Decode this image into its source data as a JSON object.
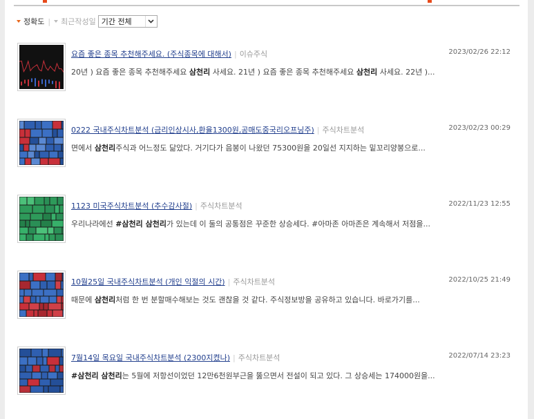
{
  "header": {
    "top_right_text": "…"
  },
  "sort": {
    "accuracy_label": "정확도",
    "recent_label": "최근작성일",
    "period_selected": "기간 전체"
  },
  "results": [
    {
      "title": "요즘 좋은 종목 추천해주세요. (주식종목에 대해서)",
      "category": "이슈주식",
      "date": "2023/02/26 22:12",
      "snippet_parts": [
        {
          "t": "20년 ) 요즘 좋은 종목 추천해주세요 ",
          "b": false
        },
        {
          "t": "삼천리",
          "b": true
        },
        {
          "t": " 사세요. 21년 ) 요즘 좋은 종목 추천해주세요 ",
          "b": false
        },
        {
          "t": "삼천리",
          "b": true
        },
        {
          "t": " 사세요. 22년 )...",
          "b": false
        }
      ],
      "thumb_style": "dark"
    },
    {
      "title": "0222 국내주식차트분석 (금리인상시사,환율1300원,공매도중국리오프닝주)",
      "category": "주식차트분석",
      "date": "2023/02/23 00:29",
      "snippet_parts": [
        {
          "t": "면에서 ",
          "b": false
        },
        {
          "t": "삼천리",
          "b": true
        },
        {
          "t": "주식과 어느정도 닮았다. 거기다가 음봉이 나왔던 75300원을 20일선 지지하는 밑꼬리양봉으로...",
          "b": false
        }
      ],
      "thumb_style": "blue"
    },
    {
      "title": "1123 미국주식차트분석 (추수감사절)",
      "category": "주식차트분석",
      "date": "2022/11/23 12:55",
      "snippet_parts": [
        {
          "t": "우리나라에선 ",
          "b": false
        },
        {
          "t": "#삼천리 삼천리",
          "b": true
        },
        {
          "t": "가 있는데 이 둘의 공통점은 꾸준한 상승세다. #아마존 아마존은 계속해서 저점을...",
          "b": false
        }
      ],
      "thumb_style": "green"
    },
    {
      "title": "10월25일 국내주식차트분석 (개인 익절의 시간)",
      "category": "주식차트분석",
      "date": "2022/10/25 21:49",
      "snippet_parts": [
        {
          "t": "때문에 ",
          "b": false
        },
        {
          "t": "삼천리",
          "b": true
        },
        {
          "t": "처럼 한 번 분할매수해보는 것도 괜찮을 것 같다. 주식정보방을 공유하고 있습니다. 바로가기를...",
          "b": false
        }
      ],
      "thumb_style": "mixed"
    },
    {
      "title": "7월14일 목요일 국내주식차트분석 (2300지켰나)",
      "category": "주식차트분석",
      "date": "2022/07/14 23:23",
      "snippet_parts": [
        {
          "t": "#삼천리 삼천리",
          "b": true
        },
        {
          "t": "는 5월에 저항선이었던 12만6천원부근을 뚫으면서 전설이 되고 있다. 그 상승세는 174000원을...",
          "b": false
        }
      ],
      "thumb_style": "mixed2"
    }
  ],
  "colors": {
    "link": "#1f3d8c",
    "accent": "#e8671a",
    "treemap_red": "#c8303a",
    "treemap_blue": "#2f5fb0",
    "treemap_green": "#2e9a5a"
  }
}
